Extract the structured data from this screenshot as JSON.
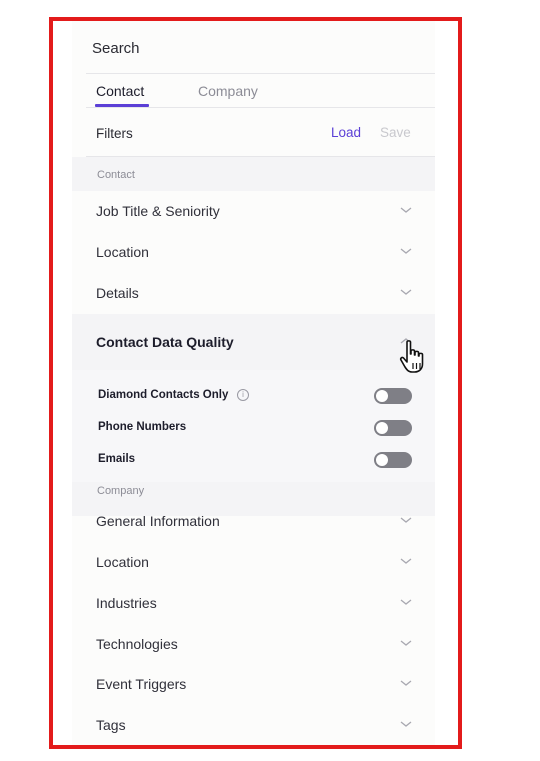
{
  "search": {
    "title": "Search"
  },
  "tabs": [
    {
      "label": "Contact",
      "active": true
    },
    {
      "label": "Company",
      "active": false
    }
  ],
  "filters": {
    "label": "Filters",
    "load_label": "Load",
    "save_label": "Save"
  },
  "contact_section": {
    "label": "Contact",
    "items": [
      {
        "label": "Job Title & Seniority"
      },
      {
        "label": "Location"
      },
      {
        "label": "Details"
      }
    ],
    "expanded": {
      "label": "Contact Data Quality",
      "toggles": [
        {
          "label": "Diamond Contacts Only",
          "on": false,
          "has_info_icon": true
        },
        {
          "label": "Phone Numbers",
          "on": false
        },
        {
          "label": "Emails",
          "on": false
        }
      ]
    }
  },
  "company_section": {
    "label": "Company",
    "items": [
      {
        "label": "General Information"
      },
      {
        "label": "Location"
      },
      {
        "label": "Industries"
      },
      {
        "label": "Technologies"
      },
      {
        "label": "Event Triggers"
      },
      {
        "label": "Tags"
      }
    ]
  },
  "colors": {
    "accent": "#5b3fd6",
    "frame_border": "#e31b1b",
    "toggle_off": "#7f7f86"
  },
  "icons": {
    "collapsed": "chevron-down-icon",
    "expanded": "chevron-up-icon",
    "info": "info-icon",
    "cursor": "hand-pointer-cursor"
  }
}
